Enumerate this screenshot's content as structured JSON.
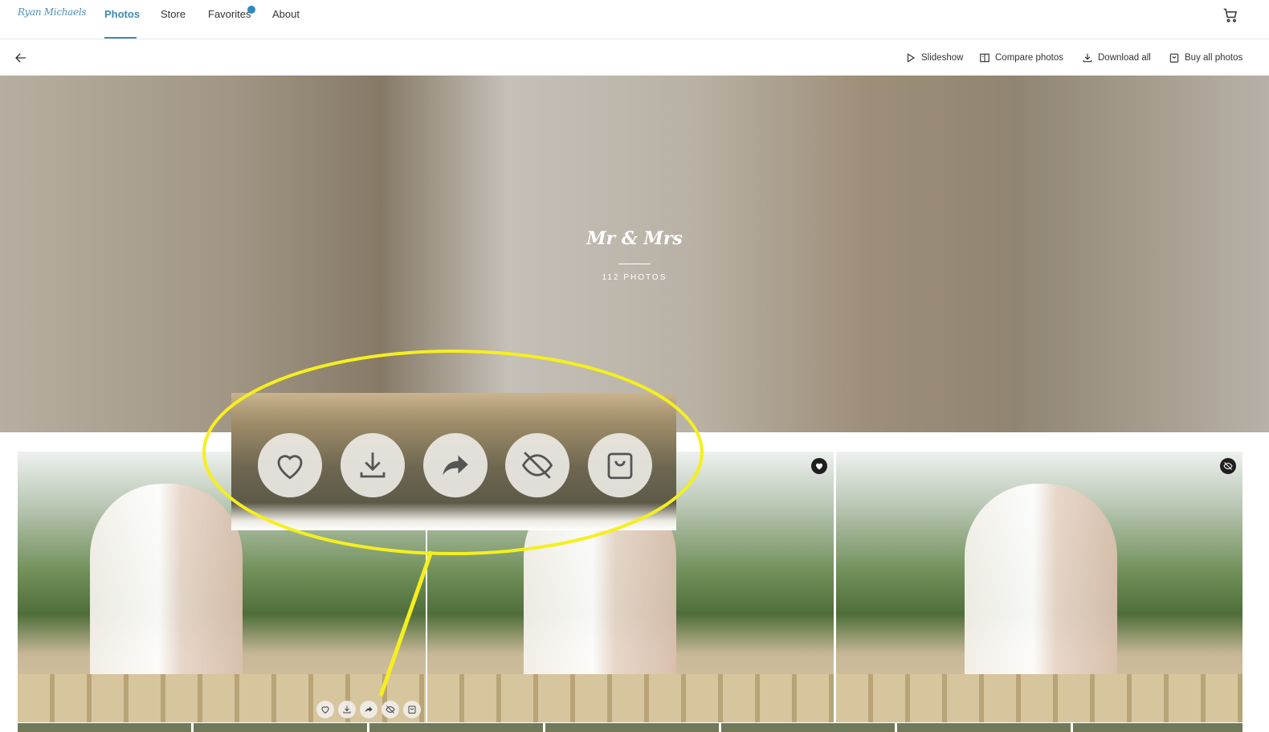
{
  "brand": {
    "logo_text": "Ryan Michaels",
    "accent": "#3d8bb5"
  },
  "nav": {
    "items": [
      {
        "label": "Photos",
        "active": true
      },
      {
        "label": "Store",
        "active": false
      },
      {
        "label": "Favorites",
        "active": false
      },
      {
        "label": "About",
        "active": false
      }
    ],
    "cart_icon": "cart-icon"
  },
  "toolbar": {
    "back_icon": "arrow-left-icon",
    "slideshow": "Slideshow",
    "compare": "Compare photos",
    "download_all": "Download all",
    "buy_all": "Buy all photos"
  },
  "album": {
    "title": "Mr & Mrs",
    "count": "112 PHOTOS"
  },
  "photos": [
    {
      "badge": "none"
    },
    {
      "badge": "heart-icon"
    },
    {
      "badge": "eye-off-icon"
    }
  ],
  "photo_actions": [
    "heart-icon",
    "download-icon",
    "share-icon",
    "eye-off-icon",
    "bag-icon"
  ],
  "annotation": {
    "color": "#f5ef1f"
  }
}
